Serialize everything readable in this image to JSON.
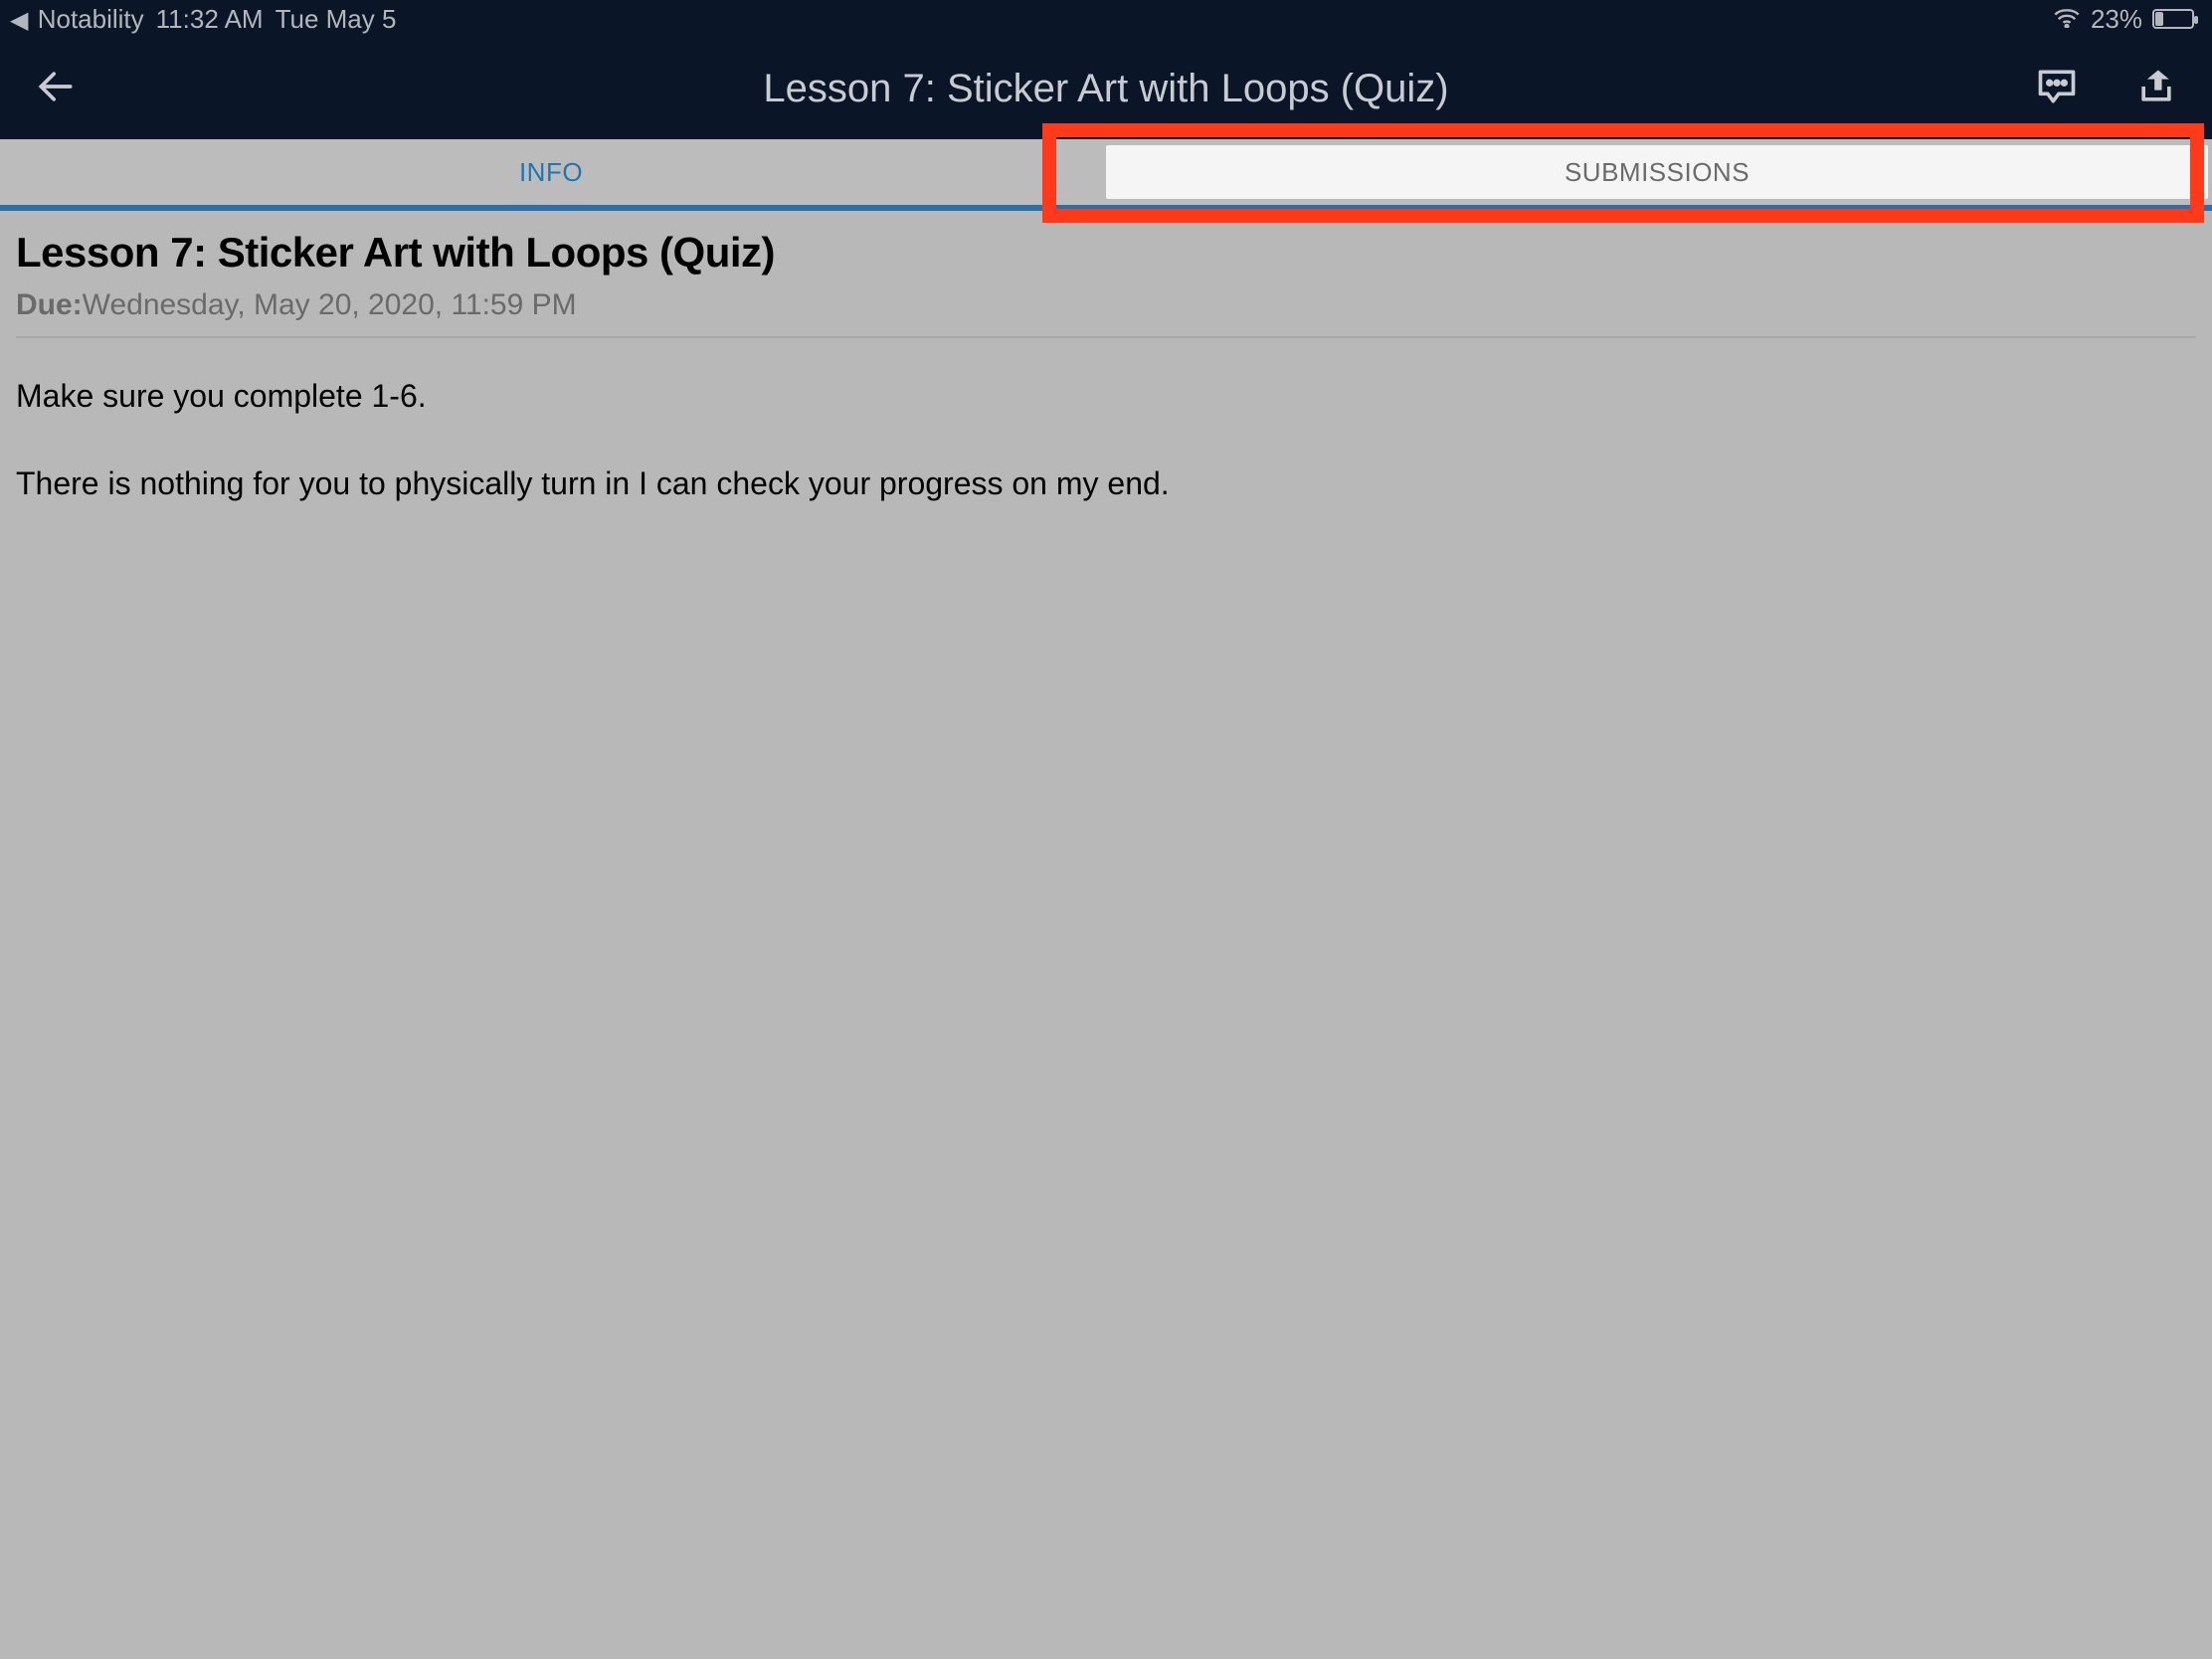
{
  "status": {
    "back_app": "Notability",
    "time": "11:32 AM",
    "date": "Tue May 5",
    "battery_pct": "23%"
  },
  "nav": {
    "title": "Lesson 7: Sticker Art with Loops (Quiz)"
  },
  "tabs": {
    "info": "INFO",
    "submissions": "SUBMISSIONS"
  },
  "content": {
    "title": "Lesson 7: Sticker Art with Loops (Quiz)",
    "due_label": "Due:",
    "due_value": "Wednesday, May 20, 2020, 11:59 PM",
    "para1": "Make sure you complete 1-6.",
    "para2": "There is nothing for you to physically turn in I can check your progress on my end."
  }
}
